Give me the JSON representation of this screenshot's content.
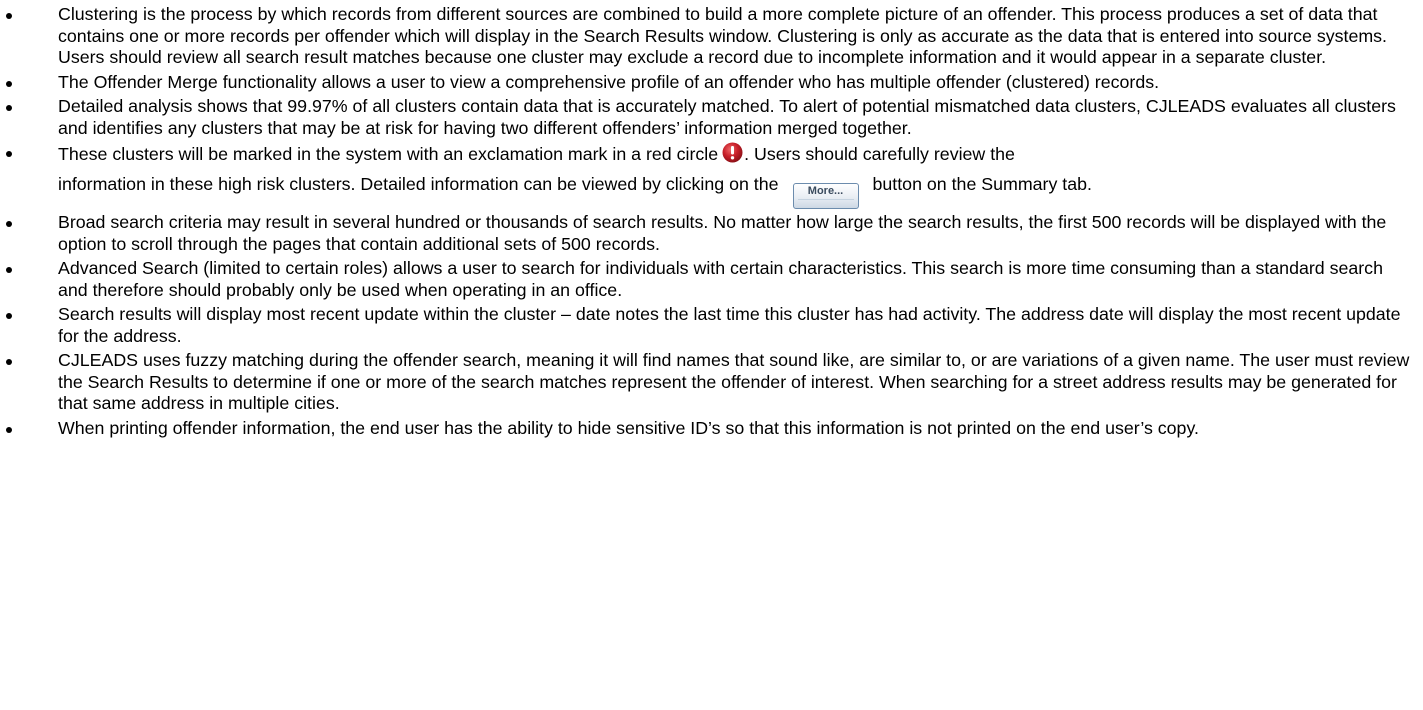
{
  "document": {
    "bullets": [
      {
        "text": "Clustering is the process by which records from different sources are combined to build a more complete picture of an offender. This process produces a set of data that contains one or more records per offender which will display in the Search Results window.  Clustering is only as accurate as the data that is entered into source systems.  Users should review all search result matches because one cluster may exclude a record due to incomplete information and it would appear in a separate cluster."
      },
      {
        "text": "The Offender Merge functionality allows a user to view a comprehensive profile of an offender who has multiple offender (clustered) records."
      },
      {
        "text": "Detailed analysis shows that 99.97% of all clusters contain data that is accurately matched.  To alert of potential mismatched data clusters, CJLEADS evaluates all clusters and identifies any clusters that may be at risk for having two different offenders’ information merged together."
      },
      {
        "text_before_icon": "These clusters will be marked in the system with an exclamation mark in a red circle",
        "text_after_icon": ".  Users should carefully review the",
        "text_before_button": "information in these high risk clusters.  Detailed information can be viewed by clicking on the",
        "button_label": "More...",
        "text_after_button": "button on the Summary tab.",
        "icon": "alert-exclamation-icon",
        "icon_color": "#c8202a"
      },
      {
        "text": "Broad search criteria may result in several hundred or thousands of search results.  No matter how large the search results, the first 500 records will be displayed with the option to scroll through the pages that contain additional sets of 500 records."
      },
      {
        "text": "Advanced Search (limited to certain roles) allows a user to search for individuals with certain characteristics.  This search is more time consuming than a standard search and therefore should probably only be used when operating in an office."
      },
      {
        "text": "Search results will display most recent update within the cluster – date notes the last time this cluster has had activity.   The address date will display the most recent update for the address."
      },
      {
        "text": "CJLEADS uses fuzzy matching during the offender search, meaning it will find names that sound like, are similar to, or are variations of a given name.  The user must review the Search Results to determine if one or more of the search matches represent the offender of interest.   When searching for a street address results may be generated for that same address in multiple cities."
      },
      {
        "text": "When printing offender information, the end user has the ability to hide sensitive ID’s so that this information is not printed on the end user’s copy."
      }
    ]
  }
}
